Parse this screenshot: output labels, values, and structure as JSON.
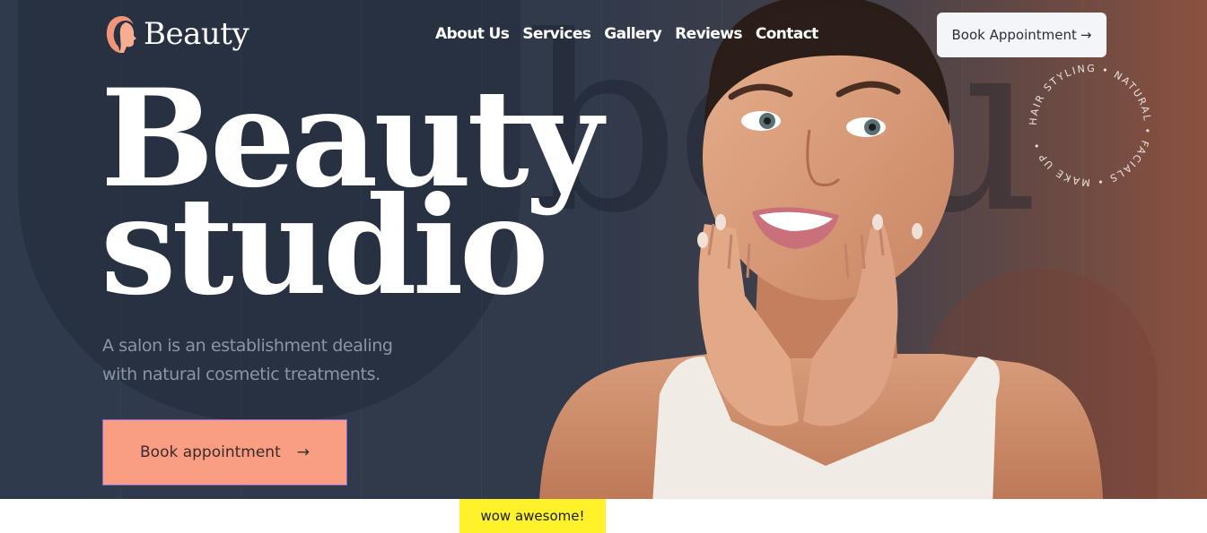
{
  "brand": {
    "name": "Beauty"
  },
  "nav": {
    "items": [
      "About Us",
      "Services",
      "Gallery",
      "Reviews",
      "Contact"
    ]
  },
  "header": {
    "book_label": "Book Appointment",
    "book_arrow": "→"
  },
  "hero": {
    "heading_line1": "Beauty",
    "heading_line2": "studio",
    "background_word": "be u",
    "description": "A salon is an establishment dealing with natural cosmetic treatments.",
    "cta_label": "Book appointment",
    "cta_arrow": "→"
  },
  "badge": {
    "ring_text": "HAIR STYLING • NATURAL • FACIALS • MAKE UP •"
  },
  "footer_strip": {
    "tag": "wow awesome!"
  },
  "colors": {
    "accent": "#fa9e83",
    "hero_bg": "#313a4b",
    "highlight": "#fff22a",
    "button_light": "#f3f5f9"
  }
}
